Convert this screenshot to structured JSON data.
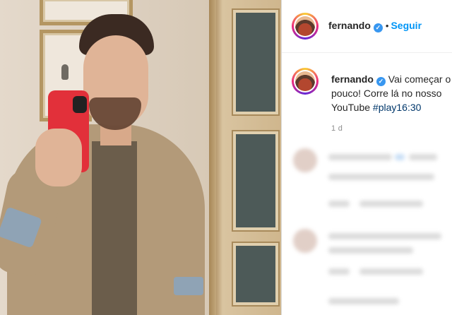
{
  "post": {
    "username": "fernando",
    "follow_label": "Seguir",
    "separator": "•",
    "caption_line1": "Vai começar o",
    "caption_line2": "pouco! Corre lá no nosso",
    "caption_line3": "YouTube",
    "hashtag": "#play16:30",
    "time": "1 d"
  },
  "icons": {
    "verified": "verified-badge-icon",
    "verified_glyph": "✓"
  },
  "colors": {
    "accent": "#0095f6",
    "verified": "#3897f0",
    "phone": "#e2303a",
    "hashtag": "#00376b"
  }
}
